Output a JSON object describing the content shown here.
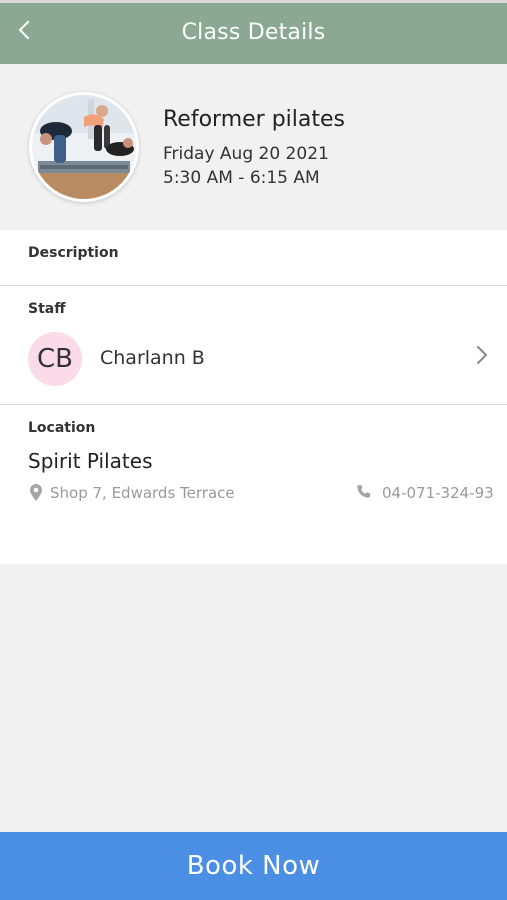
{
  "header": {
    "title": "Class Details",
    "back_icon": "chevron-left-icon",
    "background": "#8aa892"
  },
  "class": {
    "name": "Reformer pilates",
    "date": "Friday Aug 20 2021",
    "time": "5:30 AM - 6:15 AM",
    "image": "pilates-class-photo"
  },
  "description": {
    "label": "Description"
  },
  "staff": {
    "label": "Staff",
    "initials": "CB",
    "name": "Charlann B",
    "avatar_color": "#fadbe7"
  },
  "location": {
    "label": "Location",
    "name": "Spirit Pilates",
    "address": "Shop 7, Edwards Terrace",
    "phone": "04-071-324-93"
  },
  "book_button": {
    "label": "Book Now",
    "color": "#4a8fe3"
  }
}
